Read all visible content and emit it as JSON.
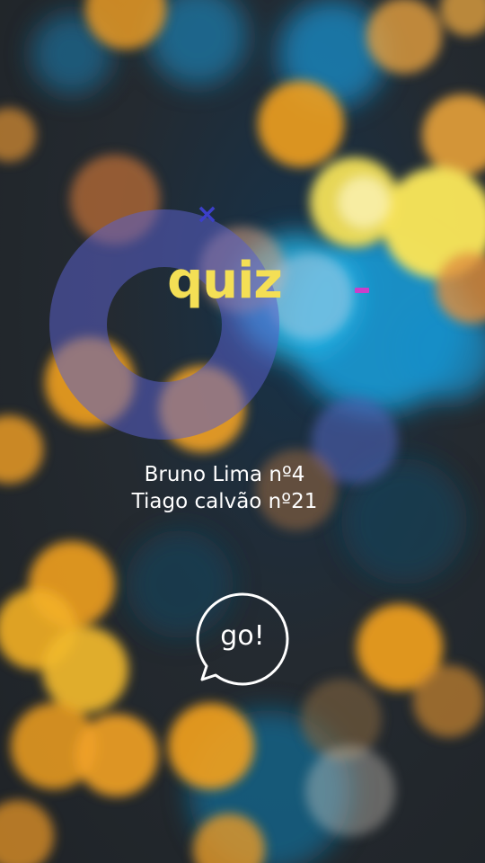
{
  "app": {
    "title": "quiz"
  },
  "authors": [
    "Bruno Lima nº4",
    "Tiago calvão nº21"
  ],
  "go_button": {
    "label": "go!",
    "icon": "speech-bubble-icon"
  },
  "decorations": {
    "x_mark": "×",
    "x_color": "#3c3fc9",
    "dash_color": "#c93fc9",
    "ring_color": "#5a5fc8"
  },
  "colors": {
    "title": "#f4df55",
    "text": "#ffffff",
    "bokeh_orange": "#f0a020",
    "bokeh_yellow": "#f5e25a",
    "bokeh_blue": "#1e9fd8"
  }
}
